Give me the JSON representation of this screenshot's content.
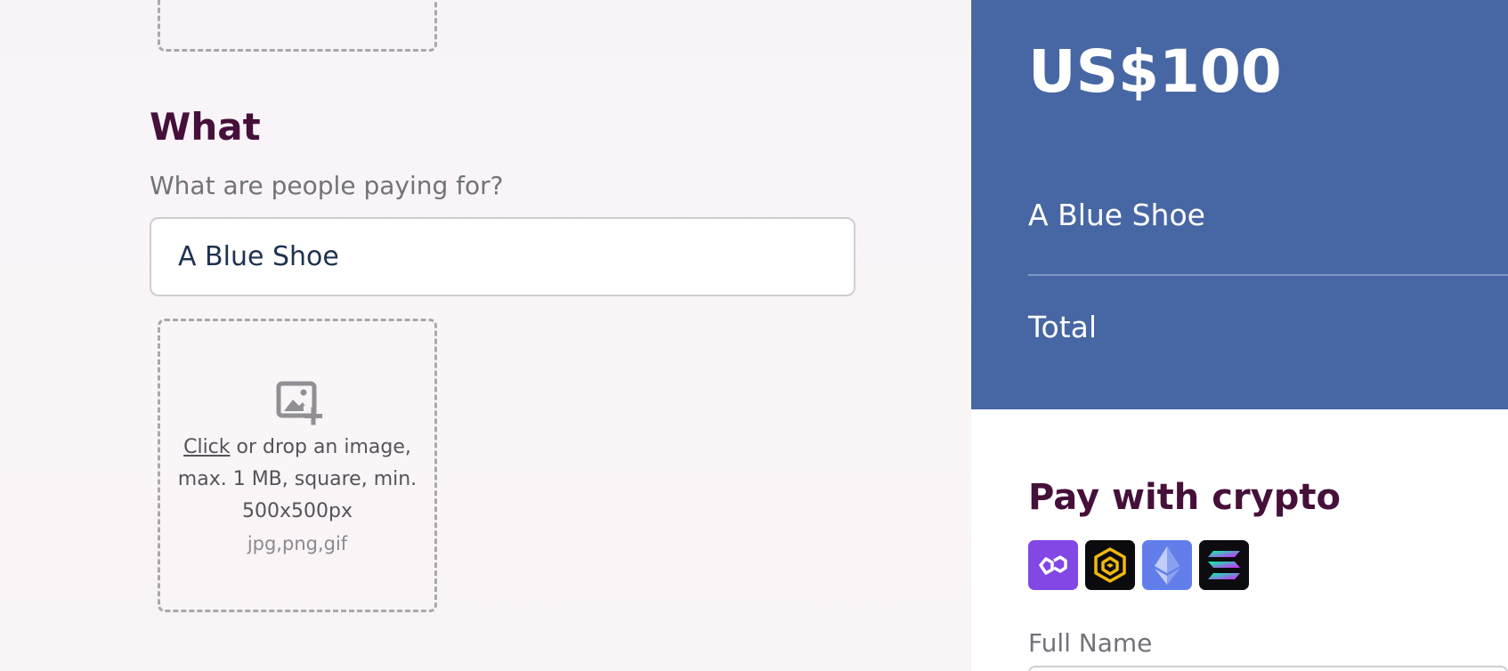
{
  "colors": {
    "accent": "#4766a4",
    "heading": "#45103a"
  },
  "what": {
    "title": "What",
    "subtitle": "What are people paying for?",
    "value": "A Blue Shoe"
  },
  "upload": {
    "click_label": "Click",
    "instructions": " or drop an image, max. 1 MB, square, min. 500x500px",
    "formats": "jpg,png,gif",
    "icon": "add-image-icon"
  },
  "summary": {
    "price": "US$100",
    "item_name": "A Blue Shoe",
    "total_label": "Total"
  },
  "pay": {
    "title": "Pay with crypto",
    "coins": [
      "polygon-icon",
      "bnb-icon",
      "ethereum-icon",
      "solana-icon"
    ]
  },
  "form": {
    "full_name_label": "Full Name"
  }
}
